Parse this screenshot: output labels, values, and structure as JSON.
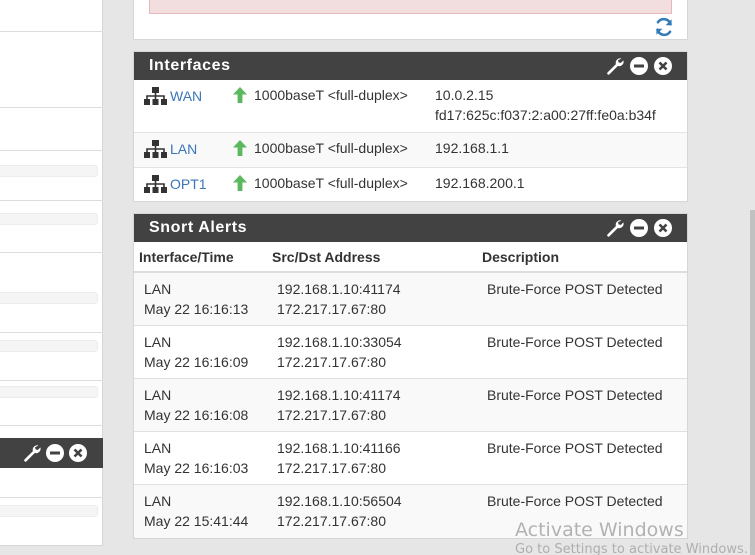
{
  "interfaces_widget": {
    "title": "Interfaces",
    "rows": [
      {
        "name": "WAN",
        "status": "up",
        "media": "1000baseT <full-duplex>",
        "ipv4": "10.0.2.15",
        "ipv6": "fd17:625c:f037:2:a00:27ff:fe0a:b34f"
      },
      {
        "name": "LAN",
        "status": "up",
        "media": "1000baseT <full-duplex>",
        "ipv4": "192.168.1.1",
        "ipv6": ""
      },
      {
        "name": "OPT1",
        "status": "up",
        "media": "1000baseT <full-duplex>",
        "ipv4": "192.168.200.1",
        "ipv6": ""
      }
    ]
  },
  "snort_widget": {
    "title": "Snort Alerts",
    "headers": {
      "interface_time": "Interface/Time",
      "src_dst": "Src/Dst Address",
      "description": "Description"
    },
    "rows": [
      {
        "iface": "LAN",
        "time": "May 22 16:16:13",
        "src": "192.168.1.10:41174",
        "dst": "172.217.17.67:80",
        "desc": "Brute-Force POST Detected"
      },
      {
        "iface": "LAN",
        "time": "May 22 16:16:09",
        "src": "192.168.1.10:33054",
        "dst": "172.217.17.67:80",
        "desc": "Brute-Force POST Detected"
      },
      {
        "iface": "LAN",
        "time": "May 22 16:16:08",
        "src": "192.168.1.10:41174",
        "dst": "172.217.17.67:80",
        "desc": "Brute-Force POST Detected"
      },
      {
        "iface": "LAN",
        "time": "May 22 16:16:03",
        "src": "192.168.1.10:41166",
        "dst": "172.217.17.67:80",
        "desc": "Brute-Force POST Detected"
      },
      {
        "iface": "LAN",
        "time": "May 22 15:41:44",
        "src": "192.168.1.10:56504",
        "dst": "172.217.17.67:80",
        "desc": "Brute-Force POST Detected"
      }
    ]
  },
  "watermark": {
    "line1": "Activate Windows",
    "line2": "Go to Settings to activate Windows."
  },
  "colors": {
    "panel_header": "#424242",
    "link": "#3a76b8",
    "status_up": "#5cb85c",
    "refresh": "#337ab7",
    "alert_box": "#f2dede"
  },
  "icons": {
    "settings": "wrench-icon",
    "minimize": "minus-circle-icon",
    "close": "close-circle-icon",
    "network": "sitemap-icon",
    "status_up": "arrow-up-icon",
    "refresh": "refresh-icon"
  }
}
